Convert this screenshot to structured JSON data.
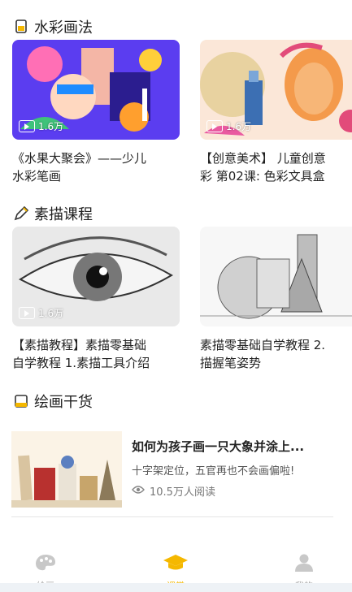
{
  "sections": {
    "watercolor": {
      "title": "水彩画法"
    },
    "sketch": {
      "title": "素描课程"
    },
    "tips": {
      "title": "绘画干货"
    }
  },
  "watercolor_cards": [
    {
      "title_line1": "《水果大聚会》——少儿",
      "title_line2": "水彩笔画",
      "views": "1.6万"
    },
    {
      "title_line1": "【创意美术】 儿童创意",
      "title_line2": "彩 第02课: 色彩文具盒",
      "views": "1.6万"
    }
  ],
  "sketch_cards": [
    {
      "title_line1": "【素描教程】素描零基础",
      "title_line2": "自学教程 1.素描工具介绍",
      "views": "1.6万"
    },
    {
      "title_line1": "素描零基础自学教程 2.",
      "title_line2": "描握笔姿势",
      "views": ""
    }
  ],
  "article": {
    "title": "如何为孩子画一只大象并涂上...",
    "subtitle": "十字架定位，五官再也不会画偏啦!",
    "reads": "10.5万人阅读"
  },
  "tabbar": {
    "tabs": [
      {
        "label": "绘画",
        "icon": "palette-icon",
        "active": false
      },
      {
        "label": "课堂",
        "icon": "graduation-cap-icon",
        "active": true
      },
      {
        "label": "我的",
        "icon": "user-icon",
        "active": false
      }
    ]
  },
  "colors": {
    "accent": "#f5b800",
    "inactive": "#c8c8c8"
  }
}
